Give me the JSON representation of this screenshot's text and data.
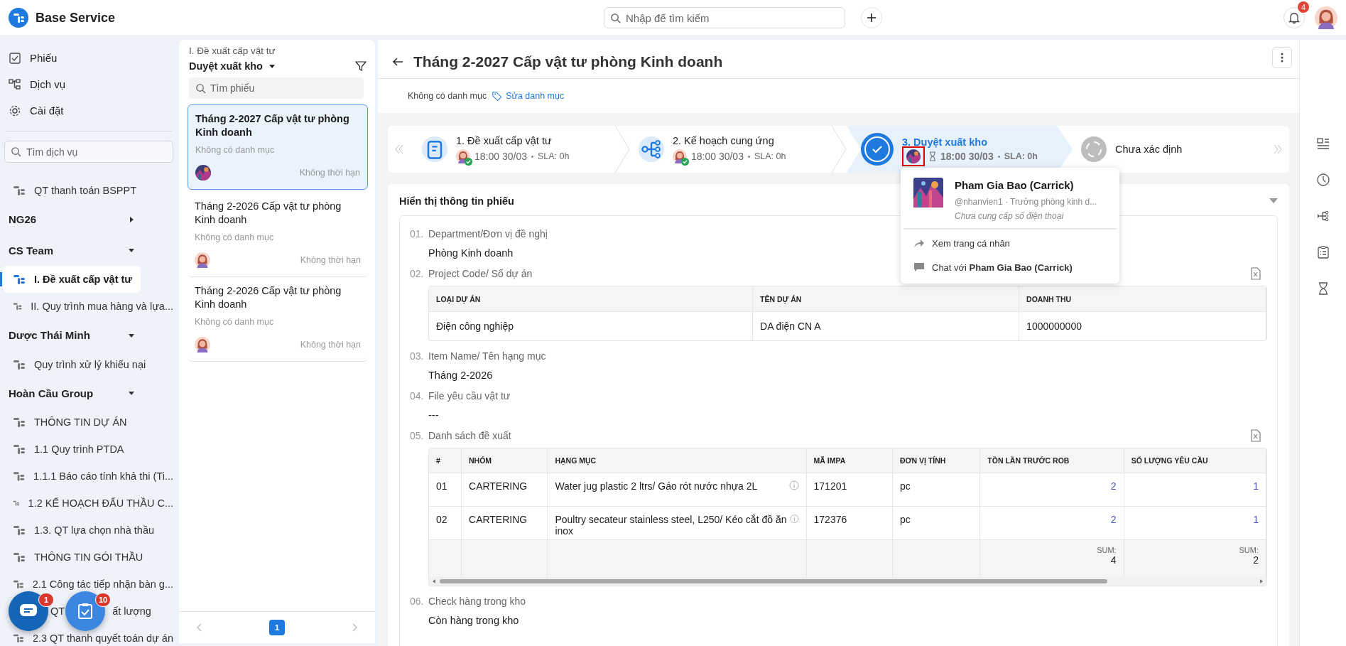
{
  "app": {
    "name": "Base Service"
  },
  "search": {
    "placeholder": "Nhập để tìm kiếm"
  },
  "notifications": {
    "count": "4"
  },
  "nav": [
    {
      "label": "Phiếu"
    },
    {
      "label": "Dịch vụ"
    },
    {
      "label": "Cài đặt"
    }
  ],
  "service_search": {
    "placeholder": "Tìm dịch vụ"
  },
  "tree": [
    {
      "kind": "item",
      "label": "QT thanh toán BSPPT",
      "selected": false
    },
    {
      "kind": "group",
      "label": "NG26",
      "expanded": false
    },
    {
      "kind": "group",
      "label": "CS Team",
      "expanded": true,
      "children": [
        {
          "kind": "item",
          "label": "I. Đề xuất cấp vật tư",
          "selected": true
        },
        {
          "kind": "item",
          "label": "II. Quy trình mua hàng và lựa...",
          "selected": false
        }
      ]
    },
    {
      "kind": "group",
      "label": "Dược Thái Minh",
      "expanded": true,
      "children": [
        {
          "kind": "item",
          "label": "Quy trình xử lý khiếu nại",
          "selected": false
        }
      ]
    },
    {
      "kind": "group",
      "label": "Hoàn Cầu Group",
      "expanded": true,
      "children": [
        {
          "kind": "item",
          "label": "THÔNG TIN DỰ ÁN",
          "selected": false
        },
        {
          "kind": "item",
          "label": "1.1 Quy trình PTDA",
          "selected": false
        },
        {
          "kind": "item",
          "label": "1.1.1 Báo cáo tính khả thi (Ti...",
          "selected": false
        },
        {
          "kind": "item",
          "label": "1.2 KẾ HOẠCH ĐẤU THẦU C...",
          "selected": false
        },
        {
          "kind": "item",
          "label": "1.3. QT lựa chọn nhà thầu",
          "selected": false
        },
        {
          "kind": "item",
          "label": "THÔNG TIN GÓI THẦU",
          "selected": false
        },
        {
          "kind": "item",
          "label": "2.1 Công tác tiếp nhận bàn g...",
          "selected": false
        },
        {
          "kind": "item",
          "label": "QT",
          "label_continued": "ất lượng",
          "selected": false
        },
        {
          "kind": "item",
          "label": "2.3 QT thanh quyết toán dự án",
          "selected": false
        }
      ]
    }
  ],
  "floating": {
    "chat_badge": "1",
    "tasks_badge": "10"
  },
  "ticket_list": {
    "breadcrumb": "I. Đề xuất cấp vật tư",
    "view": "Duyệt xuất kho",
    "search_placeholder": "Tìm phiếu",
    "tickets": [
      {
        "title": "Tháng 2-2027 Cấp vật tư phòng Kinh doanh",
        "category": "Không có danh mục",
        "deadline": "Không thời hạn",
        "avatar": {
          "kind": "artwork"
        },
        "selected": true
      },
      {
        "title": "Tháng 2-2026 Cấp vật tư phòng Kinh doanh",
        "category": "Không có danh mục",
        "deadline": "Không thời hạn",
        "avatar": {
          "kind": "person"
        },
        "selected": false
      },
      {
        "title": "Tháng 2-2026 Cấp vật tư phòng Kinh doanh",
        "category": "Không có danh mục",
        "deadline": "Không thời hạn",
        "avatar": {
          "kind": "person"
        },
        "selected": false
      }
    ],
    "pages": [
      {
        "label": "1",
        "selected": true
      }
    ]
  },
  "detail": {
    "title": "Tháng 2-2027 Cấp vật tư phòng Kinh doanh",
    "category": "Không có danh mục",
    "edit_category": "Sửa danh mục",
    "steps": [
      {
        "label": "1. Đề xuất cấp vật tư",
        "kind": "done",
        "avatar": {
          "kind": "person"
        },
        "time": "18:00 30/03",
        "sla": "SLA: 0h"
      },
      {
        "label": "2. Kế hoạch cung ứng",
        "kind": "done",
        "avatar": {
          "kind": "person"
        },
        "time": "18:00 30/03",
        "sla": "SLA: 0h"
      },
      {
        "label": "3. Duyệt xuất kho",
        "kind": "current",
        "avatar": {
          "kind": "artwork"
        },
        "time": "18:00 30/03",
        "sla": "SLA: 0h"
      },
      {
        "label": "Chưa xác định",
        "kind": "pending"
      }
    ],
    "section": {
      "title": "Hiển thị thông tin phiếu",
      "expanded": true
    },
    "fields": [
      {
        "number": "01.",
        "label": "Department/Đơn vị đề nghị",
        "kind": "text",
        "value": "Phòng Kinh doanh"
      },
      {
        "number": "02.",
        "label": "Project Code/ Số dự án",
        "kind": "table",
        "columns": [
          {
            "label": "LOẠI DỰ ÁN",
            "numeric": false
          },
          {
            "label": "TÊN DỰ ÁN",
            "numeric": false
          },
          {
            "label": "DOANH THU",
            "numeric": false
          }
        ],
        "rows": [
          {
            "cells": [
              "Điện công nghiệp",
              "DA điện CN A",
              "1000000000"
            ]
          }
        ]
      },
      {
        "number": "03.",
        "label": "Item Name/ Tên hạng mục",
        "kind": "text",
        "value": "Tháng 2-2026"
      },
      {
        "number": "04.",
        "label": "File yêu cầu vật tư",
        "kind": "text",
        "value": "---"
      },
      {
        "number": "05.",
        "label": "Danh sách đề xuất",
        "kind": "table",
        "columns": [
          {
            "label": "#",
            "numeric": false
          },
          {
            "label": "NHÓM",
            "numeric": false
          },
          {
            "label": "HẠNG MỤC",
            "numeric": false
          },
          {
            "label": "MÃ IMPA",
            "numeric": false
          },
          {
            "label": "ĐƠN VỊ TÍNH",
            "numeric": false
          },
          {
            "label": "TỒN LẦN TRƯỚC ROB",
            "numeric": true
          },
          {
            "label": "SỐ LƯỢNG YÊU CẦU",
            "numeric": true
          }
        ],
        "rows": [
          {
            "cells": [
              "01",
              "CARTERING",
              {
                "text": "Water jug plastic 2 ltrs/ Gáo rót nước nhựa 2L",
                "info": true
              },
              "171201",
              "pc",
              "2",
              "1"
            ]
          },
          {
            "cells": [
              "02",
              "CARTERING",
              {
                "text": "Poultry secateur stainless steel, L250/ Kéo cắt đồ ăn inox",
                "info": true
              },
              "172376",
              "pc",
              "2",
              "1"
            ]
          }
        ],
        "footer": [
          {
            "caption": "SUM:",
            "value": "4"
          },
          {
            "caption": "SUM:",
            "value": "2"
          }
        ]
      },
      {
        "number": "06.",
        "label": "Check hàng trong kho",
        "kind": "text",
        "value": "Còn hàng trong kho"
      }
    ]
  },
  "popup": {
    "name": "Pham Gia Bao (Carrick)",
    "subtitle": "@nhanvien1 · Trưởng phòng kinh d...",
    "phone_note": "Chưa cung cấp số điện thoại",
    "actions": [
      {
        "kind": "profile",
        "label": "Xem trang cá nhân"
      },
      {
        "kind": "chat",
        "label": "Chat với **Pham Gia Bao (Carrick)**"
      }
    ]
  }
}
